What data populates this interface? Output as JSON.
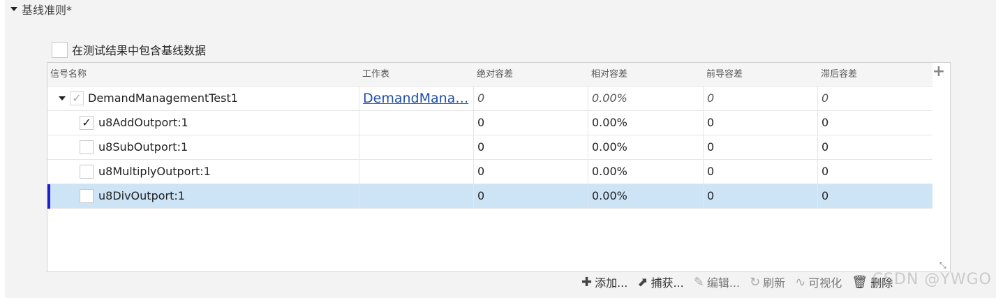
{
  "section": {
    "title": "基线准则*"
  },
  "include_baseline": {
    "label": "在测试结果中包含基线数据",
    "checked": false
  },
  "table": {
    "headers": [
      "信号名称",
      "工作表",
      "绝对容差",
      "相对容差",
      "前导容差",
      "滞后容差"
    ],
    "group": {
      "name": "DemandManagementTest1",
      "worksheet": "DemandMana…",
      "abs": "0",
      "rel": "0.00%",
      "lead": "0",
      "lag": "0"
    },
    "rows": [
      {
        "name": "u8AddOutport:1",
        "checked": true,
        "abs": "0",
        "rel": "0.00%",
        "lead": "0",
        "lag": "0"
      },
      {
        "name": "u8SubOutport:1",
        "checked": false,
        "abs": "0",
        "rel": "0.00%",
        "lead": "0",
        "lag": "0"
      },
      {
        "name": "u8MultiplyOutport:1",
        "checked": false,
        "abs": "0",
        "rel": "0.00%",
        "lead": "0",
        "lag": "0"
      },
      {
        "name": "u8DivOutport:1",
        "checked": false,
        "abs": "0",
        "rel": "0.00%",
        "lead": "0",
        "lag": "0"
      }
    ]
  },
  "toolbar": {
    "add": "添加...",
    "capture": "捕获...",
    "edit": "编辑...",
    "refresh": "刷新",
    "visualize": "可视化",
    "delete": "删除"
  },
  "watermark": "CSDN @YWGO",
  "icons": {
    "add": "plus-icon",
    "capture": "capture-icon",
    "edit": "pencil-icon",
    "refresh": "refresh-icon",
    "visualize": "chart-icon",
    "delete": "trash-icon"
  },
  "colors": {
    "selected_row": "#cde4f7",
    "selection_bar": "#1d1dd6",
    "link": "#1f4fa8"
  }
}
